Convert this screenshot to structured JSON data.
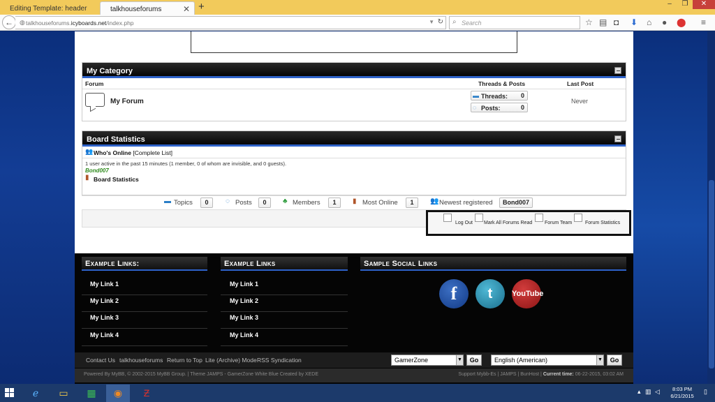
{
  "browser": {
    "tabs": [
      {
        "title": "Editing Template: header"
      },
      {
        "title": "talkhouseforums"
      }
    ],
    "url_host_prefix": "talkhouseforums.",
    "url_domain": "icyboards.net",
    "url_path": "/index.php",
    "search_placeholder": "Search"
  },
  "category": {
    "title": "My Category",
    "col_forum": "Forum",
    "col_threads_posts": "Threads & Posts",
    "col_last_post": "Last Post",
    "forum_name": "My Forum",
    "threads_label": "Threads:",
    "threads_value": "0",
    "posts_label": "Posts:",
    "posts_value": "0",
    "last_post": "Never"
  },
  "board_stats": {
    "title": "Board Statistics",
    "whos_online": "Who's Online",
    "complete_list": "[Complete List]",
    "online_text": "1 user active in the past 15 minutes (1 member, 0 of whom are invisible, and 0 guests).",
    "online_user": "Bond007",
    "stats_heading": "Board Statistics",
    "topics_label": "Topics",
    "topics_value": "0",
    "posts_label": "Posts",
    "posts_value": "0",
    "members_label": "Members",
    "members_value": "1",
    "most_online_label": "Most Online",
    "most_online_value": "1",
    "newest_label": "Newest registered",
    "newest_value": "Bond007"
  },
  "user_links": [
    "Log Out",
    "Mark All Forums Read",
    "Forum Team",
    "Forum Statistics"
  ],
  "footer": {
    "col1_title": "Example Links:",
    "col1_links": [
      "My Link 1",
      "My Link 2",
      "My Link 3",
      "My Link 4"
    ],
    "col2_title": "Example Links",
    "col2_links": [
      "My Link 1",
      "My Link 2",
      "My Link 3",
      "My Link 4"
    ],
    "col3_title": "Sample Social Links",
    "social": [
      "f",
      "t",
      "YouTube"
    ],
    "nav_links": [
      "Contact Us",
      "talkhouseforums",
      "Return to Top",
      "Lite (Archive) Mode",
      "RSS Syndication"
    ],
    "theme_select": "GamerZone",
    "lang_select": "English (American)",
    "go_label": "Go",
    "copyright_left": "Powered By MyBB, © 2002-2015 MyBB Group. | Theme JAMPS - GamerZone White Blue Created by XEDE",
    "copyright_right_prefix": "Support Mybb-Es | JAMPS | BunHost | ",
    "current_time_label": "Current time:",
    "current_time_value": "06-22-2015, 03:02 AM"
  },
  "taskbar": {
    "time": "8:03 PM",
    "date": "6/21/2015"
  }
}
